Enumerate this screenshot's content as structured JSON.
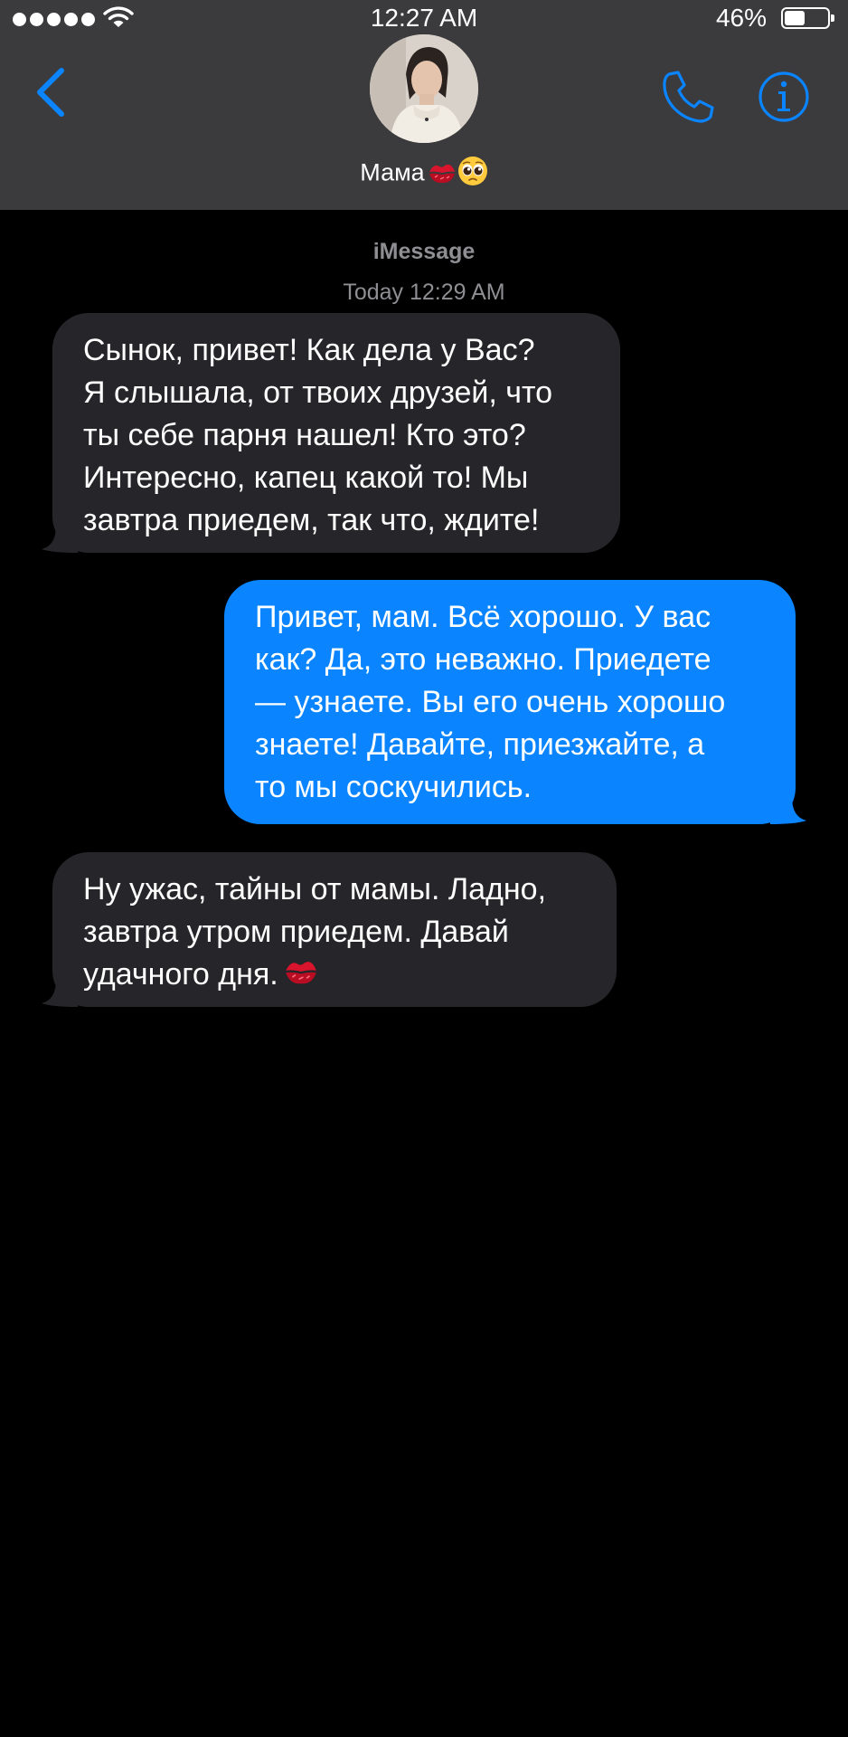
{
  "status_bar": {
    "time": "12:27 AM",
    "battery_percent": "46%",
    "battery_level": 0.46
  },
  "header": {
    "contact_name": "Мама",
    "contact_emojis": [
      "kiss-mark-icon",
      "pleading-face-icon"
    ]
  },
  "conversation": {
    "service_label": "iMessage",
    "timestamp": "Today 12:29 AM",
    "messages": [
      {
        "direction": "incoming",
        "lines": [
          "Сынок, привет! Как дела у Вас?",
          "Я слышала, от твоих друзей, что",
          "ты себе парня нашел! Кто это?",
          "Интересно, капец какой то! Мы",
          "завтра приедем, так что, ждите!"
        ]
      },
      {
        "direction": "outgoing",
        "lines": [
          "Привет, мам. Всё хорошо. У вас",
          "как? Да, это неважно. Приедете",
          "— узнаете. Вы его очень хорошо",
          "знаете! Давайте, приезжайте, а",
          "то мы соскучились."
        ]
      },
      {
        "direction": "incoming",
        "lines": [
          "Ну ужас, тайны от мамы. Ладно,",
          "завтра утром приедем. Давай",
          "удачного дня."
        ],
        "trailing_emoji": "kiss-mark-icon"
      }
    ]
  },
  "colors": {
    "header_bg": "#3b3b3d",
    "accent": "#0a84ff",
    "incoming_bubble": "#262529",
    "outgoing_bubble": "#0a84ff",
    "meta_text": "#8e8e93"
  }
}
